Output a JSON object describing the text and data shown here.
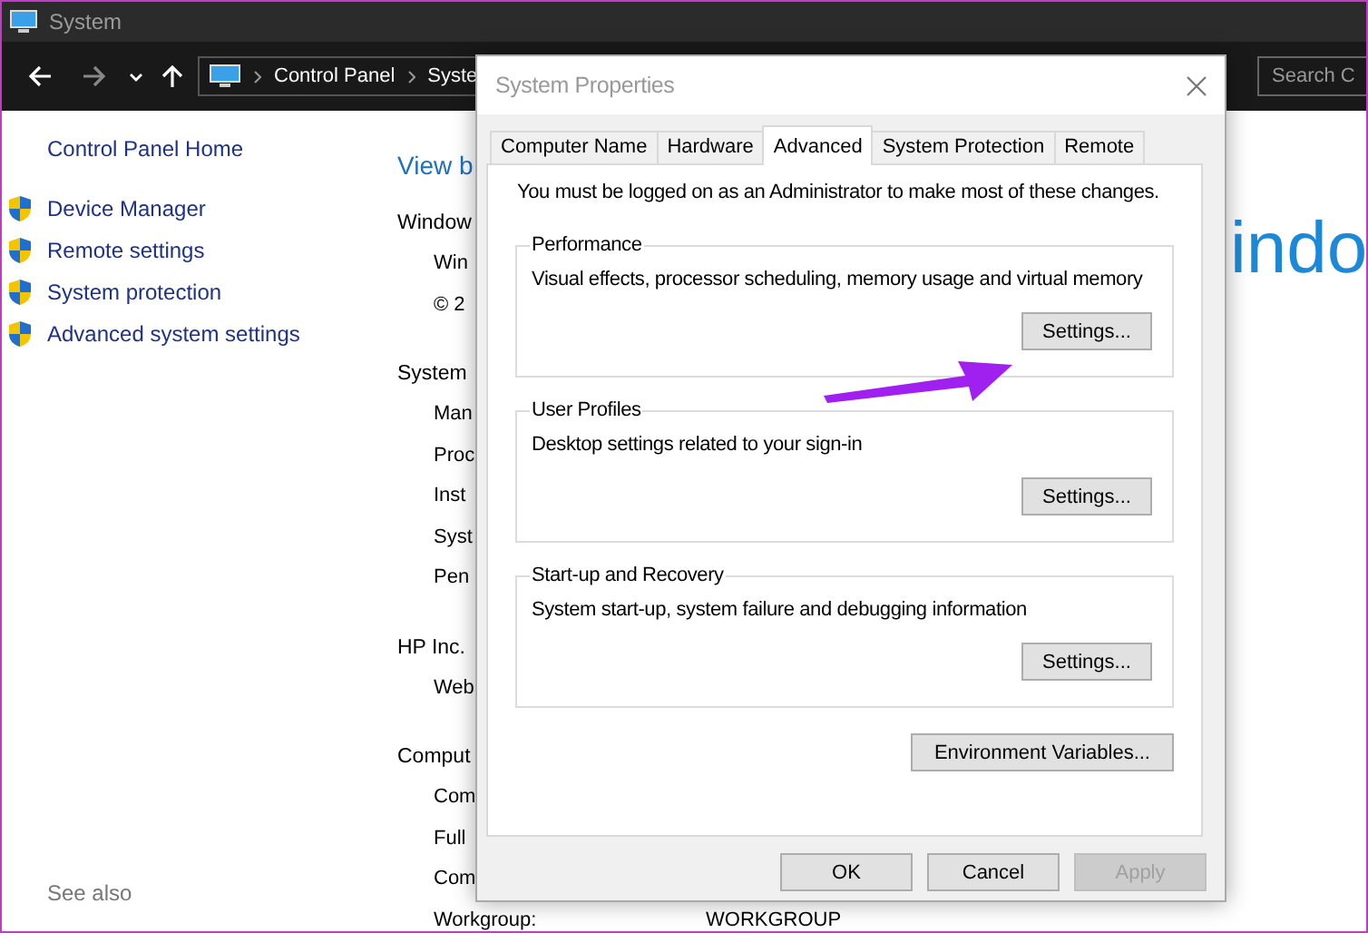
{
  "window": {
    "title": "System"
  },
  "nav": {
    "breadcrumb": [
      "Control Panel",
      "Syste"
    ],
    "search": {
      "placeholder": "Search C"
    }
  },
  "sidebar": {
    "home": "Control Panel Home",
    "items": [
      "Device Manager",
      "Remote settings",
      "System protection",
      "Advanced system settings"
    ],
    "see_also": "See also"
  },
  "main": {
    "heading": "View b",
    "logo_text": "indo",
    "sections": [
      {
        "title": "Window",
        "rows": [
          {
            "label": "Win"
          },
          {
            "label": "© 2"
          }
        ]
      },
      {
        "title": "System",
        "rows": [
          {
            "label": "Man"
          },
          {
            "label": "Proc"
          },
          {
            "label": "Inst"
          },
          {
            "label": "Syst"
          },
          {
            "label": "Pen"
          }
        ]
      },
      {
        "title": "HP Inc.",
        "rows": [
          {
            "label": "Web"
          }
        ]
      },
      {
        "title": "Comput",
        "rows": [
          {
            "label": "Com"
          },
          {
            "label": "Full"
          },
          {
            "label": "Com"
          },
          {
            "label": "Workgroup:",
            "value": "WORKGROUP"
          }
        ]
      }
    ]
  },
  "dialog": {
    "title": "System Properties",
    "tabs": [
      {
        "label": "Computer Name",
        "selected": false
      },
      {
        "label": "Hardware",
        "selected": false
      },
      {
        "label": "Advanced",
        "selected": true
      },
      {
        "label": "System Protection",
        "selected": false
      },
      {
        "label": "Remote",
        "selected": false
      }
    ],
    "notice": "You must be logged on as an Administrator to make most of these changes.",
    "groups": [
      {
        "title": "Performance",
        "description": "Visual effects, processor scheduling, memory usage and virtual memory",
        "button": "Settings..."
      },
      {
        "title": "User Profiles",
        "description": "Desktop settings related to your sign-in",
        "button": "Settings..."
      },
      {
        "title": "Start-up and Recovery",
        "description": "System start-up, system failure and debugging information",
        "button": "Settings..."
      }
    ],
    "env_button": "Environment Variables...",
    "buttons": [
      {
        "label": "OK",
        "disabled": false
      },
      {
        "label": "Cancel",
        "disabled": false
      },
      {
        "label": "Apply",
        "disabled": true
      }
    ]
  }
}
